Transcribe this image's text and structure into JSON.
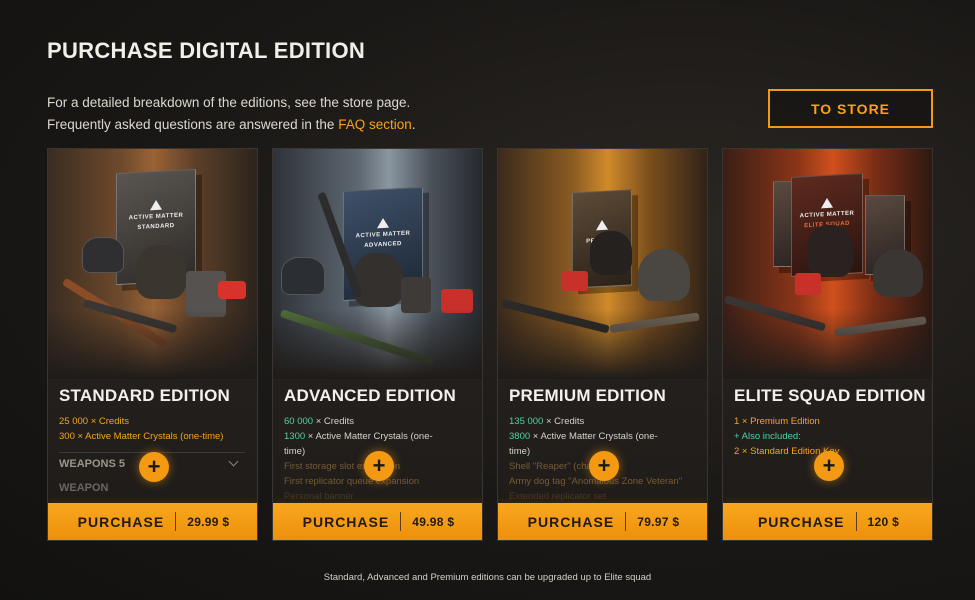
{
  "page": {
    "title": "PURCHASE DIGITAL EDITION",
    "intro_line1": "For a detailed breakdown of the editions, see the store page.",
    "intro_line2_prefix": "Frequently asked questions are answered in the ",
    "intro_link": "FAQ section",
    "intro_line2_suffix": ".",
    "store_button": "TO STORE",
    "footnote": "Standard, Advanced and Premium editions can be upgraded up to Elite squad"
  },
  "colors": {
    "accent": "#f49a12",
    "background": "#1a1816"
  },
  "cards": [
    {
      "title": "STANDARD EDITION",
      "box_label": "STANDARD",
      "brand": "ACTIVE MATTER",
      "features": [
        "25 000 × Credits",
        "300 × Active Matter Crystals (one-time)"
      ],
      "weapons_label": "WEAPONS 5",
      "weapon_label": "WEAPON",
      "purchase_label": "PURCHASE",
      "price": "29.99 $",
      "expand_symbol": "+"
    },
    {
      "title": "ADVANCED EDITION",
      "box_label": "ADVANCED",
      "brand": "ACTIVE MATTER",
      "features": [
        "60 000 × Credits",
        "1300 × Active Matter Crystals (one-",
        "time)",
        "First storage slot expansion",
        "First replicator queue expansion",
        "Personal banner"
      ],
      "purchase_label": "PURCHASE",
      "price": "49.98 $",
      "expand_symbol": "+"
    },
    {
      "title": "PREMIUM EDITION",
      "box_label": "PREMIUM",
      "brand": "ACTIVE MATTER",
      "features": [
        "135 000 × Credits",
        "3800 × Active Matter Crystals (one-",
        "time)",
        "Shell \"Reaper\" (character)",
        "Army dog tag \"Anomalous Zone Veteran\"",
        "Extended replicator set"
      ],
      "purchase_label": "PURCHASE",
      "price": "79.97 $",
      "expand_symbol": "+"
    },
    {
      "title": "ELITE SQUAD EDITION",
      "box_label": "ELITE SQUAD",
      "brand": "ACTIVE MATTER",
      "features": [
        "1 × Premium Edition",
        "+ Also included:",
        "2 × Standard Edition Key"
      ],
      "purchase_label": "PURCHASE",
      "price": "120 $",
      "expand_symbol": "+"
    }
  ]
}
